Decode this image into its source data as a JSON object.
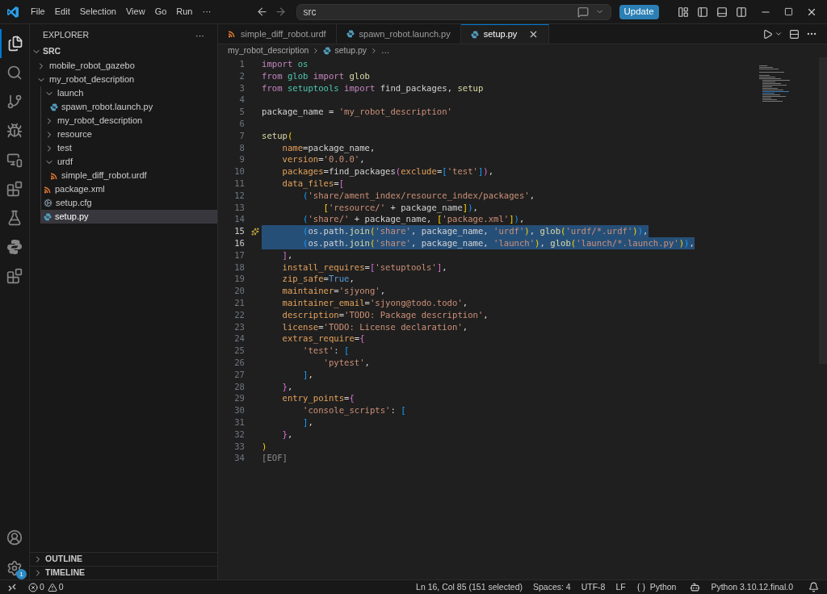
{
  "menu": [
    "File",
    "Edit",
    "Selection",
    "View",
    "Go",
    "Run",
    "···"
  ],
  "command_center": {
    "value": "src"
  },
  "update_button": "Update",
  "activity_bar": {
    "settings_badge": "1"
  },
  "explorer": {
    "title": "EXPLORER",
    "more": "···",
    "root": "SRC",
    "tree": [
      {
        "label": "mobile_robot_gazebo",
        "kind": "folder",
        "expanded": false,
        "selected": false
      },
      {
        "label": "my_robot_description",
        "kind": "folder",
        "expanded": true,
        "selected": false,
        "children": [
          {
            "label": "launch",
            "kind": "folder",
            "expanded": true,
            "selected": false,
            "children": [
              {
                "label": "spawn_robot.launch.py",
                "kind": "py",
                "selected": false
              }
            ]
          },
          {
            "label": "my_robot_description",
            "kind": "folder",
            "expanded": false,
            "selected": false
          },
          {
            "label": "resource",
            "kind": "folder",
            "expanded": false,
            "selected": false
          },
          {
            "label": "test",
            "kind": "folder",
            "expanded": false,
            "selected": false
          },
          {
            "label": "urdf",
            "kind": "folder",
            "expanded": true,
            "selected": false,
            "children": [
              {
                "label": "simple_diff_robot.urdf",
                "kind": "xml",
                "selected": false
              }
            ]
          },
          {
            "label": "package.xml",
            "kind": "xml",
            "selected": false
          },
          {
            "label": "setup.cfg",
            "kind": "cfg",
            "selected": false
          },
          {
            "label": "setup.py",
            "kind": "py",
            "selected": true
          }
        ]
      }
    ],
    "sections": [
      "OUTLINE",
      "TIMELINE"
    ]
  },
  "tabs": [
    {
      "label": "simple_diff_robot.urdf",
      "kind": "xml",
      "selected": false
    },
    {
      "label": "spawn_robot.launch.py",
      "kind": "py",
      "selected": false
    },
    {
      "label": "setup.py",
      "kind": "py",
      "selected": true
    }
  ],
  "breadcrumb": [
    "my_robot_description",
    "setup.py",
    "…"
  ],
  "editor": {
    "lines": [
      {
        "n": "1",
        "selected": false,
        "tokens": [
          {
            "kind": "kw",
            "text": "import "
          },
          {
            "kind": "mod",
            "text": "os"
          }
        ]
      },
      {
        "n": "2",
        "selected": false,
        "tokens": [
          {
            "kind": "kw",
            "text": "from "
          },
          {
            "kind": "mod",
            "text": "glob "
          },
          {
            "kind": "kw",
            "text": "import "
          },
          {
            "kind": "fn",
            "text": "glob"
          }
        ]
      },
      {
        "n": "3",
        "selected": false,
        "tokens": [
          {
            "kind": "kw",
            "text": "from "
          },
          {
            "kind": "mod",
            "text": "setuptools "
          },
          {
            "kind": "kw",
            "text": "import"
          },
          {
            "kind": "plain",
            "text": " find_packages, "
          },
          {
            "kind": "fn",
            "text": "setup"
          }
        ]
      },
      {
        "n": "4",
        "selected": false
      },
      {
        "n": "5",
        "selected": false,
        "tokens": [
          {
            "kind": "plain",
            "text": "package_name = "
          },
          {
            "kind": "str",
            "text": "'my_robot_description'"
          }
        ]
      },
      {
        "n": "6",
        "selected": false
      },
      {
        "n": "7",
        "selected": false,
        "tokens": [
          {
            "kind": "fn",
            "text": "setup"
          },
          {
            "kind": "br1",
            "text": "("
          }
        ]
      },
      {
        "n": "8",
        "selected": false,
        "tokens": [
          {
            "kind": "param",
            "text": "    name"
          },
          {
            "kind": "plain",
            "text": "=package_name,"
          }
        ]
      },
      {
        "n": "9",
        "selected": false,
        "tokens": [
          {
            "kind": "param",
            "text": "    version"
          },
          {
            "kind": "plain",
            "text": "="
          },
          {
            "kind": "str",
            "text": "'0.0.0'"
          },
          {
            "kind": "plain",
            "text": ","
          }
        ]
      },
      {
        "n": "10",
        "selected": false,
        "tokens": [
          {
            "kind": "param",
            "text": "    packages"
          },
          {
            "kind": "plain",
            "text": "=find_packages"
          },
          {
            "kind": "br2",
            "text": "("
          },
          {
            "kind": "param",
            "text": "exclude"
          },
          {
            "kind": "plain",
            "text": "="
          },
          {
            "kind": "br3",
            "text": "["
          },
          {
            "kind": "str",
            "text": "'test'"
          },
          {
            "kind": "br3",
            "text": "]"
          },
          {
            "kind": "br2",
            "text": ")"
          },
          {
            "kind": "plain",
            "text": ","
          }
        ]
      },
      {
        "n": "11",
        "selected": false,
        "tokens": [
          {
            "kind": "param",
            "text": "    data_files"
          },
          {
            "kind": "plain",
            "text": "="
          },
          {
            "kind": "br2",
            "text": "["
          }
        ]
      },
      {
        "n": "12",
        "selected": false,
        "tokens": [
          {
            "kind": "br3",
            "text": "        ("
          },
          {
            "kind": "str",
            "text": "'share/ament_index/resource_index/packages'"
          },
          {
            "kind": "plain",
            "text": ","
          }
        ]
      },
      {
        "n": "13",
        "selected": false,
        "tokens": [
          {
            "kind": "br1",
            "text": "            ["
          },
          {
            "kind": "str",
            "text": "'resource/'"
          },
          {
            "kind": "plain",
            "text": " + package_name"
          },
          {
            "kind": "br1",
            "text": "]"
          },
          {
            "kind": "br3",
            "text": ")"
          },
          {
            "kind": "plain",
            "text": ","
          }
        ]
      },
      {
        "n": "14",
        "selected": false,
        "tokens": [
          {
            "kind": "br3",
            "text": "        ("
          },
          {
            "kind": "str",
            "text": "'share/'"
          },
          {
            "kind": "plain",
            "text": " + package_name, "
          },
          {
            "kind": "br1",
            "text": "["
          },
          {
            "kind": "str",
            "text": "'package.xml'"
          },
          {
            "kind": "br1",
            "text": "]"
          },
          {
            "kind": "br3",
            "text": ")"
          },
          {
            "kind": "plain",
            "text": ","
          }
        ]
      },
      {
        "n": "15",
        "selected": true,
        "kind": "hint",
        "tokens": [
          {
            "kind": "br3",
            "text": "        ("
          },
          {
            "kind": "plain",
            "text": "os.path."
          },
          {
            "kind": "fn",
            "text": "join"
          },
          {
            "kind": "br1",
            "text": "("
          },
          {
            "kind": "str",
            "text": "'share'"
          },
          {
            "kind": "plain",
            "text": ", package_name, "
          },
          {
            "kind": "str",
            "text": "'urdf'"
          },
          {
            "kind": "br1",
            "text": ")"
          },
          {
            "kind": "plain",
            "text": ", "
          },
          {
            "kind": "fn",
            "text": "glob"
          },
          {
            "kind": "br1",
            "text": "("
          },
          {
            "kind": "str",
            "text": "'urdf/*.urdf'"
          },
          {
            "kind": "br1",
            "text": ")"
          },
          {
            "kind": "br3",
            "text": ")"
          },
          {
            "kind": "plain",
            "text": ","
          }
        ]
      },
      {
        "n": "16",
        "selected": true,
        "tokens": [
          {
            "kind": "br3",
            "text": "        ("
          },
          {
            "kind": "plain",
            "text": "os.path."
          },
          {
            "kind": "fn",
            "text": "join"
          },
          {
            "kind": "br1",
            "text": "("
          },
          {
            "kind": "str",
            "text": "'share'"
          },
          {
            "kind": "plain",
            "text": ", package_name, "
          },
          {
            "kind": "str",
            "text": "'launch'"
          },
          {
            "kind": "br1",
            "text": ")"
          },
          {
            "kind": "plain",
            "text": ", "
          },
          {
            "kind": "fn",
            "text": "glob"
          },
          {
            "kind": "br1",
            "text": "("
          },
          {
            "kind": "str",
            "text": "'launch/*.launch.py'"
          },
          {
            "kind": "br1",
            "text": ")"
          },
          {
            "kind": "br3",
            "text": ")"
          },
          {
            "kind": "plain",
            "text": ","
          }
        ]
      },
      {
        "n": "17",
        "selected": false,
        "tokens": [
          {
            "kind": "br2",
            "text": "    ]"
          },
          {
            "kind": "plain",
            "text": ","
          }
        ]
      },
      {
        "n": "18",
        "selected": false,
        "tokens": [
          {
            "kind": "param",
            "text": "    install_requires"
          },
          {
            "kind": "plain",
            "text": "="
          },
          {
            "kind": "br2",
            "text": "["
          },
          {
            "kind": "str",
            "text": "'setuptools'"
          },
          {
            "kind": "br2",
            "text": "]"
          },
          {
            "kind": "plain",
            "text": ","
          }
        ]
      },
      {
        "n": "19",
        "selected": false,
        "tokens": [
          {
            "kind": "param",
            "text": "    zip_safe"
          },
          {
            "kind": "plain",
            "text": "="
          },
          {
            "kind": "const",
            "text": "True"
          },
          {
            "kind": "plain",
            "text": ","
          }
        ]
      },
      {
        "n": "20",
        "selected": false,
        "tokens": [
          {
            "kind": "param",
            "text": "    maintainer"
          },
          {
            "kind": "plain",
            "text": "="
          },
          {
            "kind": "str",
            "text": "'sjyong'"
          },
          {
            "kind": "plain",
            "text": ","
          }
        ]
      },
      {
        "n": "21",
        "selected": false,
        "tokens": [
          {
            "kind": "param",
            "text": "    maintainer_email"
          },
          {
            "kind": "plain",
            "text": "="
          },
          {
            "kind": "str",
            "text": "'sjyong@todo.todo'"
          },
          {
            "kind": "plain",
            "text": ","
          }
        ]
      },
      {
        "n": "22",
        "selected": false,
        "tokens": [
          {
            "kind": "param",
            "text": "    description"
          },
          {
            "kind": "plain",
            "text": "="
          },
          {
            "kind": "str",
            "text": "'TODO: Package description'"
          },
          {
            "kind": "plain",
            "text": ","
          }
        ]
      },
      {
        "n": "23",
        "selected": false,
        "tokens": [
          {
            "kind": "param",
            "text": "    license"
          },
          {
            "kind": "plain",
            "text": "="
          },
          {
            "kind": "str",
            "text": "'TODO: License declaration'"
          },
          {
            "kind": "plain",
            "text": ","
          }
        ]
      },
      {
        "n": "24",
        "selected": false,
        "tokens": [
          {
            "kind": "param",
            "text": "    extras_require"
          },
          {
            "kind": "plain",
            "text": "="
          },
          {
            "kind": "br2",
            "text": "{"
          }
        ]
      },
      {
        "n": "25",
        "selected": false,
        "tokens": [
          {
            "kind": "str",
            "text": "        'test'"
          },
          {
            "kind": "plain",
            "text": ": "
          },
          {
            "kind": "br3",
            "text": "["
          }
        ]
      },
      {
        "n": "26",
        "selected": false,
        "tokens": [
          {
            "kind": "str",
            "text": "            'pytest'"
          },
          {
            "kind": "plain",
            "text": ","
          }
        ]
      },
      {
        "n": "27",
        "selected": false,
        "tokens": [
          {
            "kind": "br3",
            "text": "        ]"
          },
          {
            "kind": "plain",
            "text": ","
          }
        ]
      },
      {
        "n": "28",
        "selected": false,
        "tokens": [
          {
            "kind": "br2",
            "text": "    }"
          },
          {
            "kind": "plain",
            "text": ","
          }
        ]
      },
      {
        "n": "29",
        "selected": false,
        "tokens": [
          {
            "kind": "param",
            "text": "    entry_points"
          },
          {
            "kind": "plain",
            "text": "="
          },
          {
            "kind": "br2",
            "text": "{"
          }
        ]
      },
      {
        "n": "30",
        "selected": false,
        "tokens": [
          {
            "kind": "str",
            "text": "        'console_scripts'"
          },
          {
            "kind": "plain",
            "text": ": "
          },
          {
            "kind": "br3",
            "text": "["
          }
        ]
      },
      {
        "n": "31",
        "selected": false,
        "tokens": [
          {
            "kind": "br3",
            "text": "        ]"
          },
          {
            "kind": "plain",
            "text": ","
          }
        ]
      },
      {
        "n": "32",
        "selected": false,
        "tokens": [
          {
            "kind": "br2",
            "text": "    }"
          },
          {
            "kind": "plain",
            "text": ","
          }
        ]
      },
      {
        "n": "33",
        "selected": false,
        "tokens": [
          {
            "kind": "br1",
            "text": ")"
          }
        ]
      },
      {
        "n": "34",
        "selected": false,
        "tokens": [
          {
            "kind": "eof",
            "text": "[EOF]"
          }
        ]
      }
    ]
  },
  "status_bar": {
    "errors": "0",
    "warnings": "0",
    "items": [
      "Ln 16, Col 85 (151 selected)",
      "Spaces: 4",
      "UTF-8",
      "LF"
    ],
    "language": "Python",
    "interpreter": "Python 3.10.12.final.0"
  }
}
